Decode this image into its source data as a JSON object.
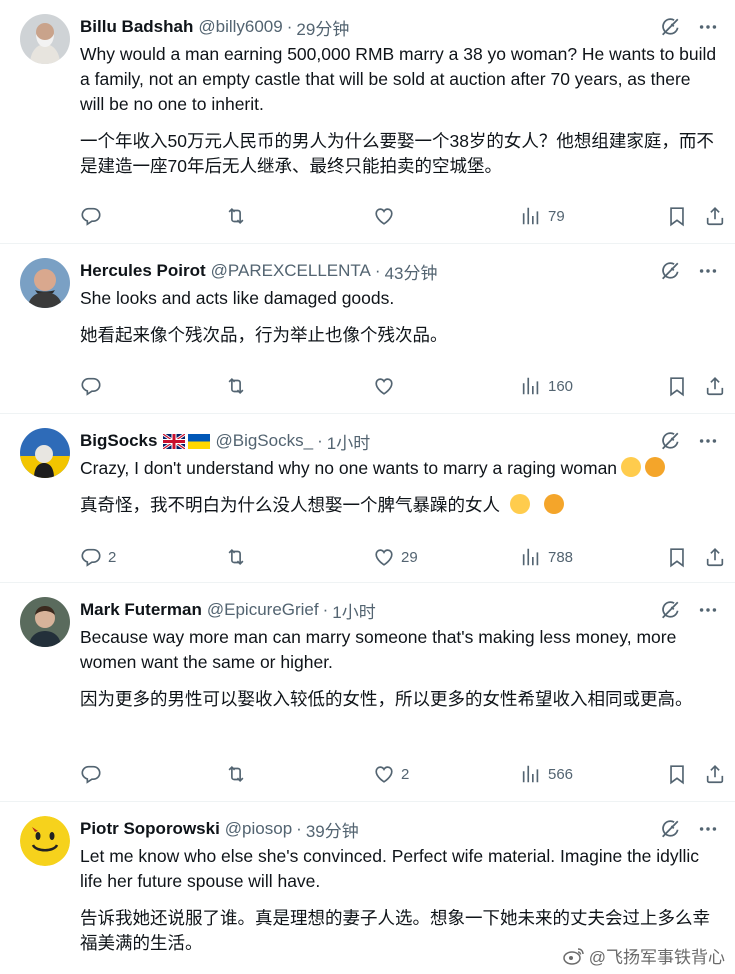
{
  "tweets": [
    {
      "name": "Billu Badshah",
      "handle": "@billy6009",
      "time": "29分钟",
      "text_en": "Why would a man earning 500,000 RMB marry a 38 yo woman? He wants to build a family, not an empty castle that will be sold at auction after 70 years, as there will be no one to inherit.",
      "text_zh": "一个年收入50万元人民币的男人为什么要娶一个38岁的女人？他想组建家庭，而不是建造一座70年后无人继承、最终只能拍卖的空城堡。",
      "replies": "",
      "retweets": "",
      "likes": "",
      "views": "79"
    },
    {
      "name": "Hercules Poirot",
      "handle": "@PAREXCELLENTA",
      "time": "43分钟",
      "text_en": "She looks and acts like damaged goods.",
      "text_zh": "她看起来像个残次品，行为举止也像个残次品。",
      "replies": "",
      "retweets": "",
      "likes": "",
      "views": "160"
    },
    {
      "name": "BigSocks",
      "handle": "@BigSocks_",
      "time": "1小时",
      "text_en": "Crazy, I don't understand why no one wants to marry a raging woman",
      "text_zh": "真奇怪，我不明白为什么没人想娶一个脾气暴躁的女人",
      "replies": "2",
      "retweets": "",
      "likes": "29",
      "views": "788"
    },
    {
      "name": "Mark Futerman",
      "handle": "@EpicureGrief",
      "time": "1小时",
      "text_en": "Because way more man can marry someone that's making less money, more women want the same or higher.",
      "text_zh": "因为更多的男性可以娶收入较低的女性，所以更多的女性希望收入相同或更高。",
      "replies": "",
      "retweets": "",
      "likes": "2",
      "views": "566"
    },
    {
      "name": "Piotr Soporowski",
      "handle": "@piosop",
      "time": "39分钟",
      "text_en": "Let me know who else she's convinced. Perfect wife material. Imagine the idyllic life her future spouse will have.",
      "text_zh": "告诉我她还说服了谁。真是理想的妻子人选。想象一下她未来的丈夫会过上多么幸福美满的生活。"
    }
  ],
  "separator_dot": "·",
  "watermark": "@飞扬军事铁背心",
  "icons": [
    "reply-icon",
    "retweet-icon",
    "like-icon",
    "views-icon",
    "bookmark-icon",
    "share-icon",
    "grok-icon",
    "more-icon"
  ],
  "colors": {
    "text": "#0f1419",
    "secondary": "#536471",
    "divider": "#eff3f4"
  }
}
